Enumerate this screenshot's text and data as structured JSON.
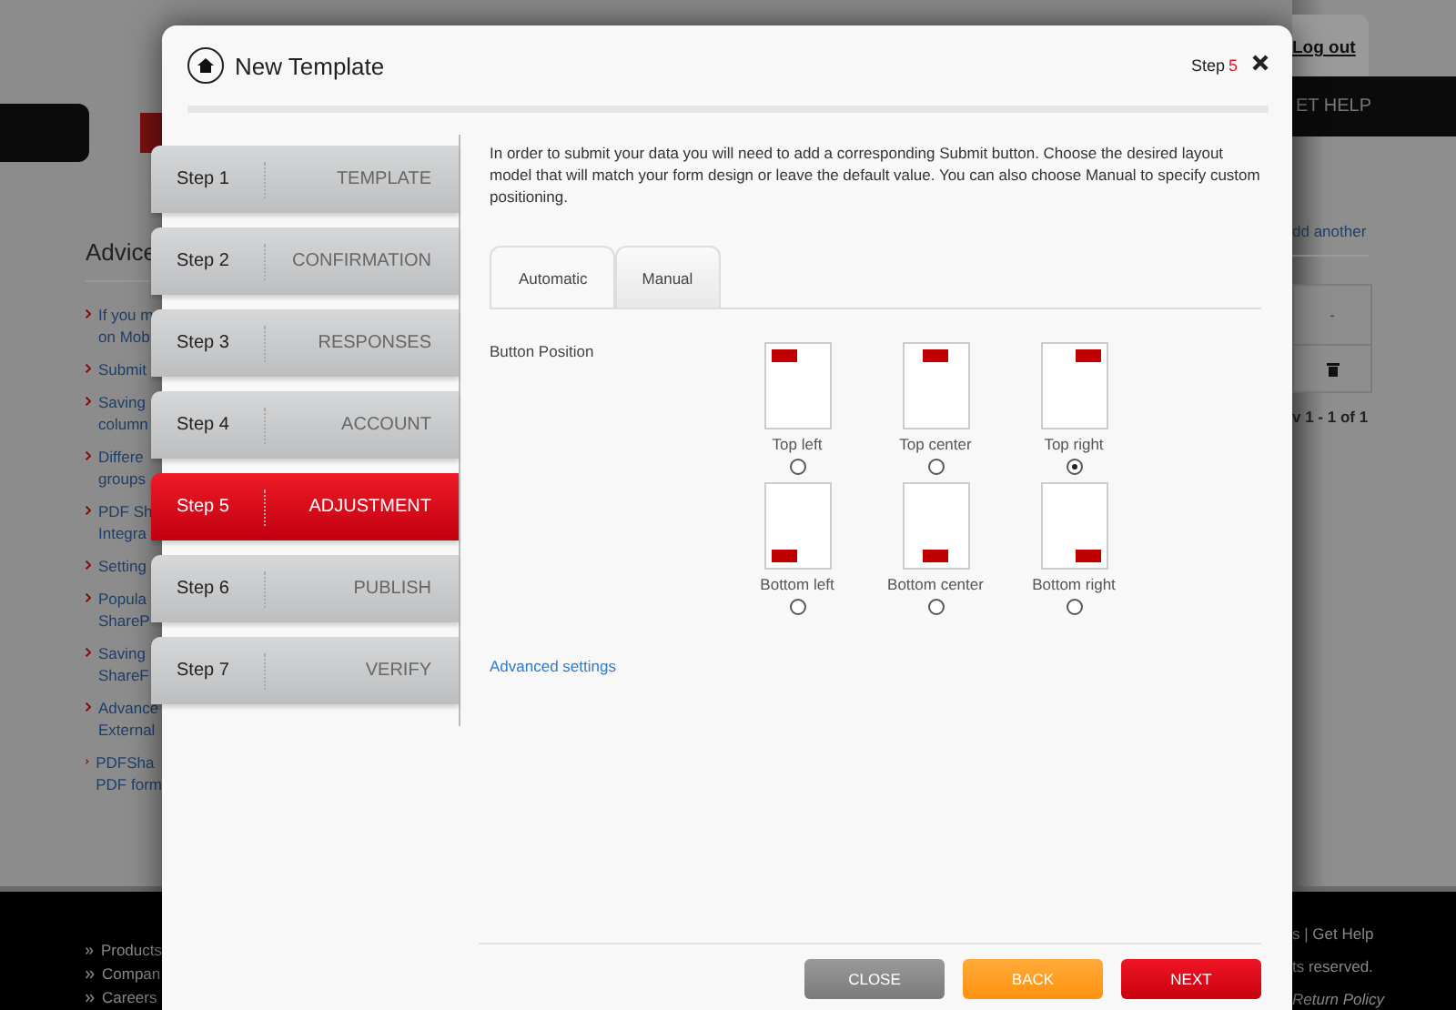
{
  "background_page": {
    "left": {
      "heading": "Advice",
      "links": [
        {
          "lines": [
            "If you m",
            "on Mob"
          ]
        },
        {
          "lines": [
            "Submit"
          ]
        },
        {
          "lines": [
            "Saving",
            "column"
          ]
        },
        {
          "lines": [
            "Differe",
            "groups"
          ]
        },
        {
          "lines": [
            "PDF Sh",
            "Integra"
          ]
        },
        {
          "lines": [
            "Setting"
          ]
        },
        {
          "lines": [
            "Popula",
            "ShareP"
          ]
        },
        {
          "lines": [
            "Saving",
            "ShareF"
          ]
        },
        {
          "lines": [
            "Advance",
            "External"
          ]
        },
        {
          "lines": [
            "PDFSha",
            "PDF form"
          ]
        }
      ],
      "footer_links": [
        "Products",
        "Compan",
        "Careers"
      ]
    },
    "right": {
      "log_out": "Log out",
      "nav_item": "ET HELP",
      "add_link": "dd another",
      "table_cell": "-",
      "pager": "v 1 - 1 of 1",
      "footer_lines": [
        "s | Get Help",
        "ts reserved.",
        "Return Policy"
      ]
    }
  },
  "dialog": {
    "title": "New Template",
    "step_indicator": {
      "label": "Step",
      "number": "5"
    },
    "steps": [
      {
        "number": "Step 1",
        "name": "TEMPLATE",
        "selected": false
      },
      {
        "number": "Step 2",
        "name": "CONFIRMATION",
        "selected": false
      },
      {
        "number": "Step 3",
        "name": "RESPONSES",
        "selected": false
      },
      {
        "number": "Step 4",
        "name": "ACCOUNT",
        "selected": false
      },
      {
        "number": "Step 5",
        "name": "ADJUSTMENT",
        "selected": true
      },
      {
        "number": "Step 6",
        "name": "PUBLISH",
        "selected": false
      },
      {
        "number": "Step 7",
        "name": "VERIFY",
        "selected": false
      }
    ],
    "intro": "In order to submit your data you will need to add a corresponding Submit button. Choose the desired layout model that will match your form design or leave the default value. You can also choose Manual to specify custom positioning.",
    "tabs": [
      {
        "label": "Automatic",
        "selected": true
      },
      {
        "label": "Manual",
        "selected": false
      }
    ],
    "position_label": "Button Position",
    "positions": [
      {
        "label": "Top left",
        "kind": "top-left",
        "selected": false
      },
      {
        "label": "Top center",
        "kind": "top-center",
        "selected": false
      },
      {
        "label": "Top right",
        "kind": "top-right",
        "selected": true
      },
      {
        "label": "Bottom left",
        "kind": "bottom-left",
        "selected": false
      },
      {
        "label": "Bottom center",
        "kind": "bottom-center",
        "selected": false
      },
      {
        "label": "Bottom right",
        "kind": "bottom-right",
        "selected": false
      }
    ],
    "advanced_link": "Advanced settings",
    "buttons": [
      {
        "label": "CLOSE",
        "kind": "close"
      },
      {
        "label": "BACK",
        "kind": "back"
      },
      {
        "label": "NEXT",
        "kind": "next"
      }
    ]
  }
}
